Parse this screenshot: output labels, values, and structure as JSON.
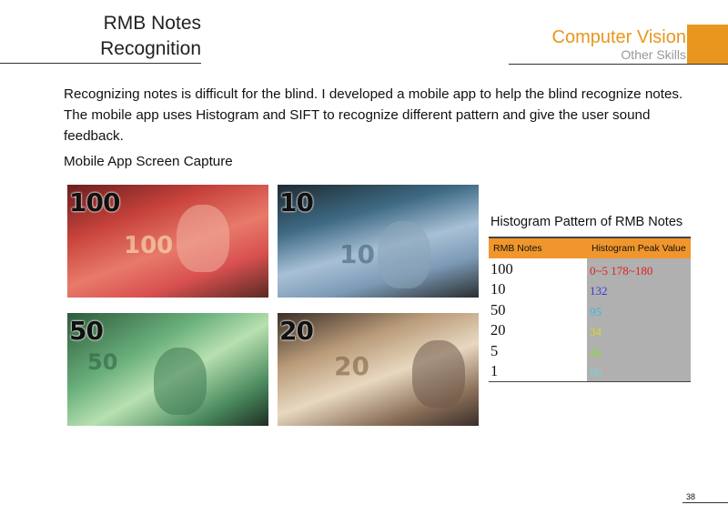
{
  "header": {
    "title_lines": [
      "RMB Notes",
      "Recognition"
    ],
    "category": "Computer Vision",
    "subcategory": "Other Skills",
    "accent_color": "#e8961e"
  },
  "body": {
    "paragraph": "Recognizing notes is difficult for the blind. I developed a mobile app to help the blind recognize notes. The mobile app uses Histogram and SIFT to recognize different pattern and give the user sound feedback.",
    "caption": "Mobile App Screen Capture"
  },
  "photos": [
    {
      "label": "100"
    },
    {
      "label": "10"
    },
    {
      "label": "50"
    },
    {
      "label": "20"
    }
  ],
  "table": {
    "title": "Histogram Pattern of RMB Notes",
    "headers": [
      "RMB Notes",
      "Histogram Peak Value"
    ],
    "header_color": "#f0962c",
    "rows": [
      {
        "note": "100",
        "peak": "0~5 178~180",
        "color": "#e02020"
      },
      {
        "note": "10",
        "peak": "132",
        "color": "#3a3ad8"
      },
      {
        "note": "50",
        "peak": "95",
        "color": "#38b8d8"
      },
      {
        "note": "20",
        "peak": "34",
        "color": "#d8d820"
      },
      {
        "note": "5",
        "peak": "46",
        "color": "#8adc3a"
      },
      {
        "note": "1",
        "peak": "86",
        "color": "#7ad0d8"
      }
    ]
  },
  "page_number": "38"
}
